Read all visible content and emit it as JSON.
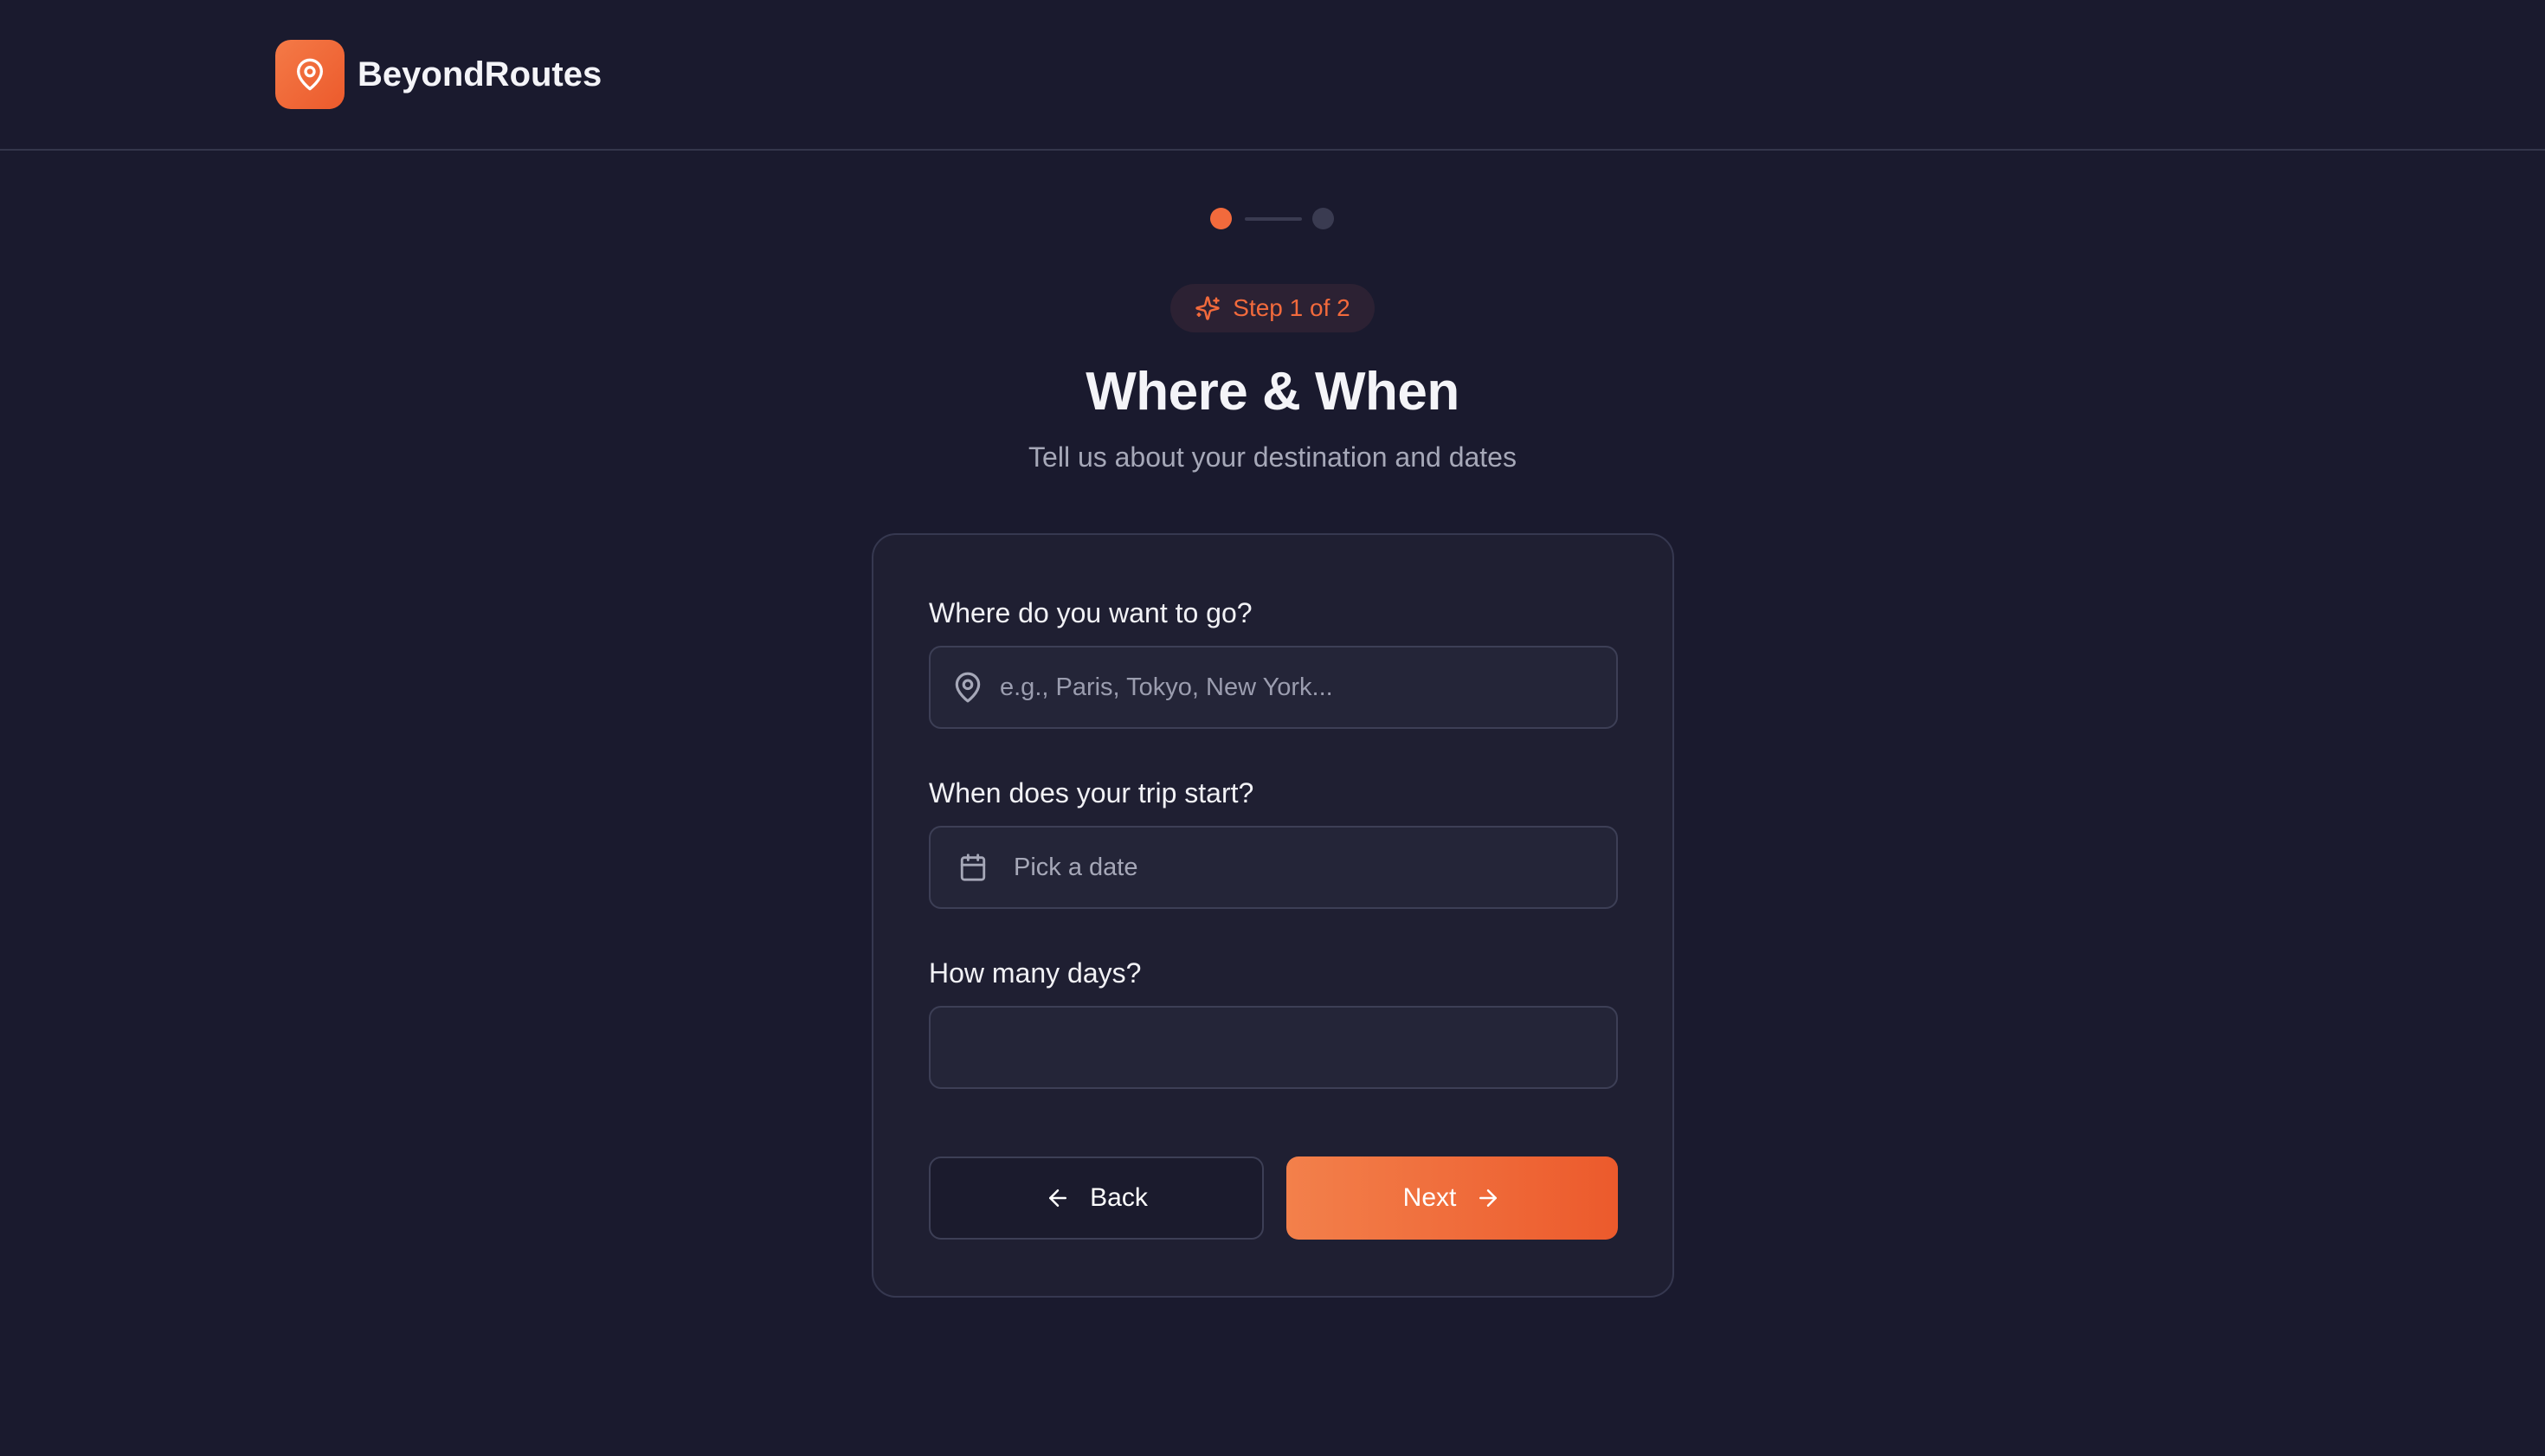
{
  "header": {
    "brand_name": "BeyondRoutes",
    "logo_icon": "map-pin-icon"
  },
  "progress": {
    "current_step": 1,
    "total_steps": 2
  },
  "step_badge": {
    "icon": "sparkles-icon",
    "label": "Step 1 of 2"
  },
  "page": {
    "title": "Where & When",
    "subtitle": "Tell us about your destination and dates"
  },
  "form": {
    "destination": {
      "label": "Where do you want to go?",
      "placeholder": "e.g., Paris, Tokyo, New York...",
      "value": "",
      "icon": "map-pin-icon"
    },
    "start_date": {
      "label": "When does your trip start?",
      "value_text": "Pick a date",
      "icon": "calendar-icon"
    },
    "days": {
      "label": "How many days?",
      "value": ""
    }
  },
  "actions": {
    "back_label": "Back",
    "back_icon": "arrow-left-icon",
    "next_label": "Next",
    "next_icon": "arrow-right-icon"
  },
  "colors": {
    "background": "#1a1a2e",
    "card": "#1f1f32",
    "accent": "#f26a3c",
    "input_bg": "#242538",
    "border": "#3d3f56"
  }
}
